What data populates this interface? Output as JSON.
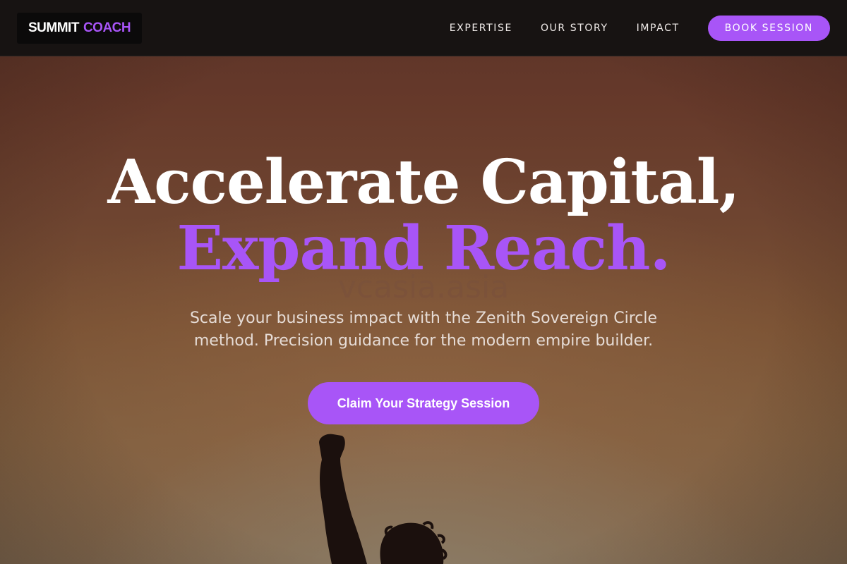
{
  "brand": {
    "logo_part1": "SUMMIT",
    "logo_part2": "COACH"
  },
  "nav": {
    "links": [
      {
        "label": "EXPERTISE"
      },
      {
        "label": "OUR STORY"
      },
      {
        "label": "IMPACT"
      }
    ],
    "cta_label": "BOOK SESSION"
  },
  "hero": {
    "headline_line1": "Accelerate Capital,",
    "headline_line2": "Expand Reach.",
    "watermark": "vcasia.asia",
    "subtitle": "Scale your business impact with the Zenith Sovereign Circle method. Precision guidance for the modern empire builder.",
    "cta_label": "Claim Your Strategy Session"
  },
  "colors": {
    "accent": "#a855f7",
    "nav_background": "#171312",
    "logo_background": "#0b0a0a",
    "headline_primary": "#ffffff",
    "subtitle": "#e6dcd6"
  },
  "icons": {
    "hero_image": "person-raising-fist-silhouette"
  }
}
